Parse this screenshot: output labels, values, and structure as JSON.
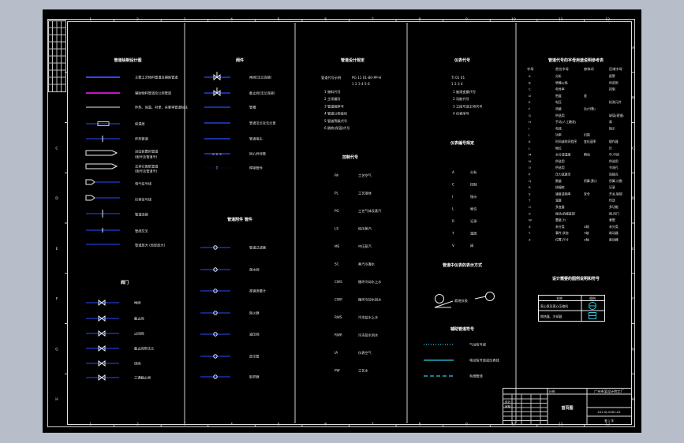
{
  "sheet": {
    "column_numbers_top": [
      "1",
      "2",
      "3",
      "4",
      "5",
      "6",
      "7",
      "8",
      "9",
      "10",
      "11",
      "12"
    ],
    "column_numbers_bottom": [
      "1",
      "2",
      "3",
      "4",
      "5",
      "6",
      "7",
      "8",
      "9",
      "10",
      "11",
      "12"
    ],
    "row_letters": [
      "A",
      "B",
      "C",
      "D",
      "E",
      "F",
      "G",
      "H"
    ],
    "col1_title": "管道绘制设计图",
    "col2_title": "阀件",
    "col2_sub_title": "管道附件  管件",
    "col3_title": "管道设计规定",
    "col3_sub_title": "控制代号",
    "col4_title": "仪表代号",
    "col4_sub_title1": "仪表编号规定",
    "col4_sub_title2": "管道中仪表的表示方式",
    "col4_sub_title3": "辅助管道符号",
    "col5_title": "管道代号的字母用途说明参考表",
    "col5_sub_title": "设计需要的图例说明和符号",
    "valves_title": "阀门"
  },
  "header_texts": {
    "pipe_code": "管道代号示例",
    "pipe_code_value": "PG 11 01-80-PP-H",
    "pipe_code_digits": "1  2  3  4  5  6",
    "inst_code": "TI 01  01",
    "inst_code_digits": "1  2  3  4"
  },
  "col5_table_header": [
    "字母",
    "首位字母",
    "修饰词",
    "后继字母"
  ],
  "col5_rows": [
    [
      "A",
      "分析",
      "",
      "报警"
    ],
    [
      "B",
      "喷嘴火焰",
      "",
      "供选用"
    ],
    [
      "C",
      "电导率",
      "",
      "控制"
    ],
    [
      "D",
      "密度",
      "差",
      ""
    ],
    [
      "E",
      "电压",
      "",
      "检测元件"
    ],
    [
      "F",
      "流量",
      "比(分数)",
      ""
    ],
    [
      "G",
      "供选用",
      "",
      "玻璃(视镜)"
    ],
    [
      "H",
      "手动(人工触发)",
      "",
      "高"
    ],
    [
      "I",
      "电流",
      "",
      "指示"
    ],
    [
      "J",
      "功率",
      "扫描",
      ""
    ],
    [
      "K",
      "时间或时间程序",
      "变化速率",
      "操作器"
    ],
    [
      "L",
      "物位",
      "",
      "灯"
    ],
    [
      "M",
      "水分或湿度",
      "瞬动",
      "中,中间"
    ],
    [
      "N",
      "供选用",
      "",
      "供选用"
    ],
    [
      "O",
      "供选用",
      "",
      "节流孔"
    ],
    [
      "P",
      "压力或真空",
      "",
      "连接点"
    ],
    [
      "Q",
      "数量",
      "积算,累计",
      "积算,计数"
    ],
    [
      "R",
      "核辐射",
      "",
      "记录"
    ],
    [
      "S",
      "速度或频率",
      "安全",
      "开关,联锁"
    ],
    [
      "T",
      "温度",
      "",
      "传送"
    ],
    [
      "U",
      "多变量",
      "",
      "多功能"
    ],
    [
      "V",
      "振动,机械监视",
      "",
      "阀,风门"
    ],
    [
      "W",
      "重量,力",
      "",
      "套管"
    ],
    [
      "X",
      "未分类",
      "X轴",
      "未分类"
    ],
    [
      "Y",
      "事件,状态",
      "Y轴",
      "继动器"
    ],
    [
      "Z",
      "位置,尺寸",
      "Z轴",
      "驱动器"
    ]
  ],
  "col1_items": [
    "主要工艺物料管道及辅助管道",
    "辅助物料管道及公用管道",
    "伴热、保温、衬里、夹套等管道标注",
    "保温层",
    "伴热管道",
    "进出装置的管道",
    "(图号及管道号)",
    "去其它图纸管道",
    "(图号及管道号)",
    "电气信号线",
    "仪表信号线",
    "管道放大 (局部放大)"
  ],
  "col1_misc": [
    "管道连接",
    "管线交叉"
  ],
  "valves": [
    "闸阀",
    "截止阀",
    "止回阀",
    "截止阀带法兰",
    "球阀",
    "三通截止阀"
  ],
  "col2_items": [
    "闸阀(法兰连接)",
    "截止阀(法兰连接)",
    "管帽",
    "管道法兰及法兰盖",
    "管道堵头",
    "同心异径管",
    "焊接管件"
  ],
  "col2_fittings": [
    "管道过滤器",
    "疏水阀",
    "视镜流量计",
    "阻火器",
    "减压阀",
    "放空管",
    "取样器"
  ],
  "col3_list": [
    "1 物料代号",
    "2 主项编号",
    "3 管道顺序号",
    "4 管道公称直径",
    "5 管道等级代号",
    "6 隔热(保温)代号"
  ],
  "col3_codes": [
    [
      "PA",
      "工艺空气"
    ],
    [
      "PL",
      "工艺液体"
    ],
    [
      "PG",
      "工艺气体及蒸汽"
    ],
    [
      "LS",
      "低压蒸汽"
    ],
    [
      "MS",
      "中压蒸汽"
    ],
    [
      "SC",
      "蒸汽冷凝水"
    ],
    [
      "CWS",
      "循环冷却水上水"
    ],
    [
      "CWR",
      "循环冷却水回水"
    ],
    [
      "RWS",
      "冷冻盐水上水"
    ],
    [
      "RWR",
      "冷冻盐水回水"
    ],
    [
      "IA",
      "仪表空气"
    ],
    [
      "PW",
      "工艺水"
    ]
  ],
  "col4_list": [
    "1 被测变量代号",
    "2 功能代号",
    "3 工段号或主项代号",
    "4 仪表序号"
  ],
  "col4_letters": [
    [
      "A",
      "分析"
    ],
    [
      "C",
      "控制"
    ],
    [
      "I",
      "指示"
    ],
    [
      "L",
      "物位"
    ],
    [
      "R",
      "记录"
    ],
    [
      "T",
      "温度"
    ],
    [
      "V",
      "阀"
    ]
  ],
  "col4_inst_label": "就地仪表",
  "col4_aux": [
    "气动信号线",
    "电动信号线或仪表线",
    "毛细管线"
  ],
  "legend_box": {
    "title": "主要设备图例",
    "headers": [
      "名称",
      "图例"
    ],
    "rows": [
      "离心泵及离心压缩机",
      "换热器、冷却器"
    ]
  },
  "title_block": {
    "company": "广州市某设计院工厂",
    "drawing_title": "首页图",
    "drawing_number": "101-SJ-2001-01",
    "designer_label": "设计",
    "checker_label": "审核",
    "scale_label": "比例",
    "sheet_label": "第 1 张"
  }
}
